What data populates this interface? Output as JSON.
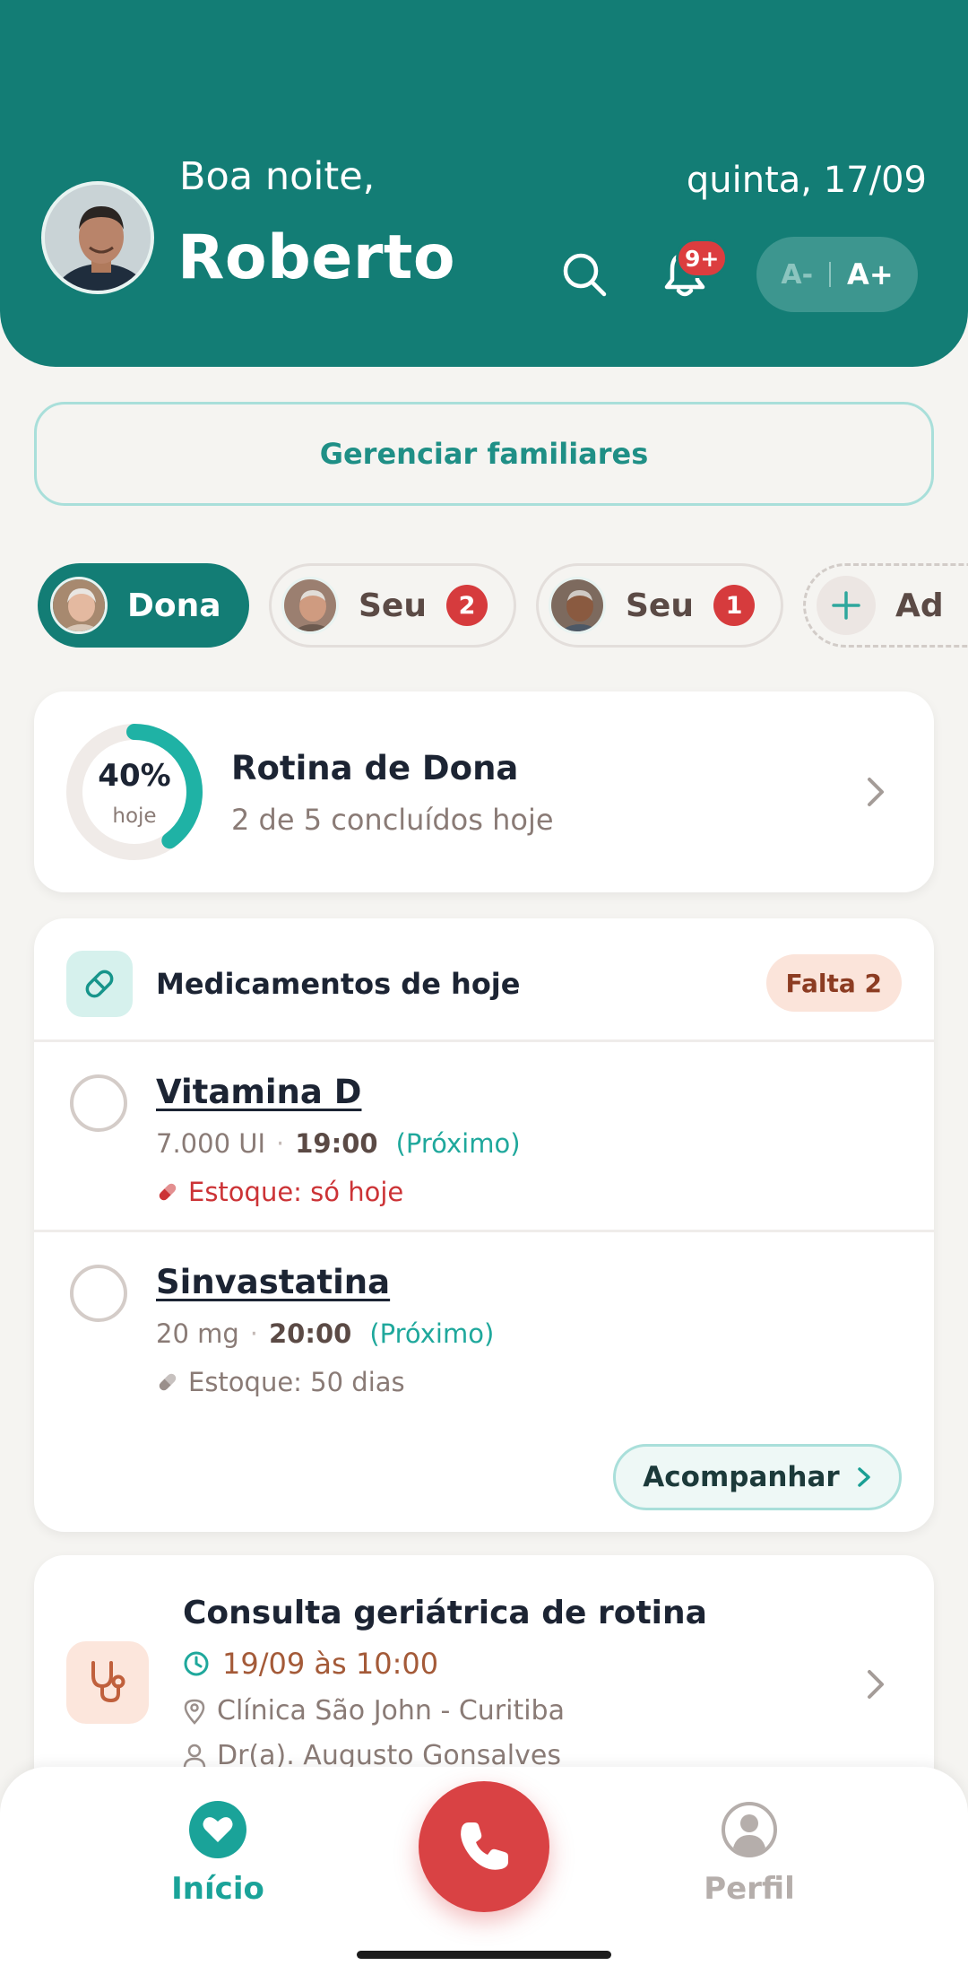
{
  "header": {
    "greeting": "Boa noite,",
    "user_name": "Roberto",
    "date": "quinta, 17/09",
    "notification_badge": "9+",
    "font_decrease": "A-",
    "font_increase": "A+"
  },
  "manage_family_label": "Gerenciar familiares",
  "family_chips": [
    {
      "label": "Dona",
      "badge": null,
      "active": true
    },
    {
      "label": "Seu",
      "badge": "2",
      "active": false
    },
    {
      "label": "Seu",
      "badge": "1",
      "active": false
    },
    {
      "label": "Ad",
      "badge": null,
      "active": false
    }
  ],
  "routine": {
    "progress_percent": 40,
    "progress_label": "40%",
    "progress_sub": "hoje",
    "title": "Rotina de Dona",
    "subtitle": "2 de 5 concluídos hoje"
  },
  "medications": {
    "title": "Medicamentos de hoje",
    "remaining_badge": "Falta 2",
    "items": [
      {
        "name": "Vitamina D",
        "dose": "7.000 UI",
        "time": "19:00",
        "tag": "(Próximo)",
        "stock": "Estoque: só hoje",
        "stock_status": "low"
      },
      {
        "name": "Sinvastatina",
        "dose": "20 mg",
        "time": "20:00",
        "tag": "(Próximo)",
        "stock": "Estoque: 50 dias",
        "stock_status": "ok"
      }
    ],
    "follow_button": "Acompanhar"
  },
  "appointment": {
    "title": "Consulta geriátrica de rotina",
    "datetime": "19/09 às 10:00",
    "location": "Clínica São John - Curitiba",
    "doctor": "Dr(a). Augusto Gonsalves"
  },
  "bottom_nav": {
    "home_label": "Início",
    "profile_label": "Perfil"
  },
  "colors": {
    "primary": "#137d75",
    "accent": "#1aa399",
    "danger": "#d94244",
    "background": "#f5f4f1"
  },
  "icons": [
    "search-icon",
    "bell-icon",
    "pill-icon",
    "stethoscope-icon",
    "clock-icon",
    "location-pin-icon",
    "person-icon",
    "chevron-right-icon",
    "heart-icon",
    "phone-icon",
    "profile-icon",
    "plus-icon"
  ]
}
